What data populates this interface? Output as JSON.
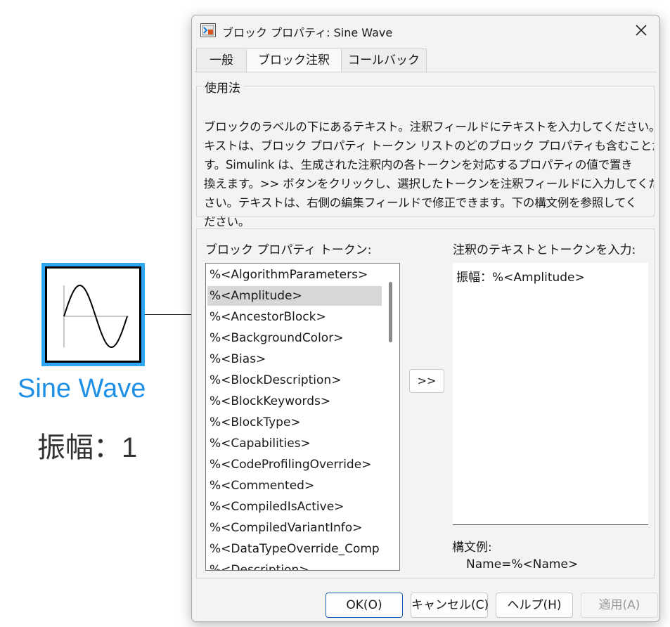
{
  "canvas": {
    "block_name": "Sine Wave",
    "block_annotation": "振幅：1",
    "accent_color": "#2ea6f2",
    "name_color": "#1e90e6"
  },
  "dialog": {
    "title": "ブロック プロパティ: Sine Wave",
    "tabs": [
      {
        "label": "一般"
      },
      {
        "label": "ブロック注釈"
      },
      {
        "label": "コールバック"
      }
    ],
    "active_tab": "ブロック注釈",
    "usage": {
      "legend": "使用法",
      "lines": [
        "ブロックのラベルの下にあるテキスト。注釈フィールドにテキストを入力してください。テ",
        "キストは、ブロック プロパティ トークン リストのどのブロック プロパティも含むことができま",
        "す。Simulink は、生成された注釈内の各トークンを対応するプロパティの値で置き",
        "換えます。>> ボタンをクリックし、選択したトークンを注釈フィールドに入力してくだ",
        "さい。テキストは、右側の編集フィールドで修正できます。下の構文例を参照してく",
        "ださい。"
      ]
    },
    "tokens_label": "ブロック プロパティ トークン:",
    "annotation_label": "注釈のテキストとトークンを入力:",
    "tokens": [
      "%<AlgorithmParameters>",
      "%<Amplitude>",
      "%<AncestorBlock>",
      "%<BackgroundColor>",
      "%<Bias>",
      "%<BlockDescription>",
      "%<BlockKeywords>",
      "%<BlockType>",
      "%<Capabilities>",
      "%<CodeProfilingOverride>",
      "%<Commented>",
      "%<CompiledIsActive>",
      "%<CompiledVariantInfo>",
      "%<DataTypeOverride_Comp",
      "%<Description>"
    ],
    "selected_token": "%<Amplitude>",
    "insert_button": ">>",
    "annotation_value": "振幅：%<Amplitude>",
    "syntax_label": "構文例:",
    "syntax_example": "Name=%<Name>",
    "buttons": {
      "ok": "OK(O)",
      "cancel": "キャンセル(C)",
      "help": "ヘルプ(H)",
      "apply": "適用(A)"
    }
  }
}
